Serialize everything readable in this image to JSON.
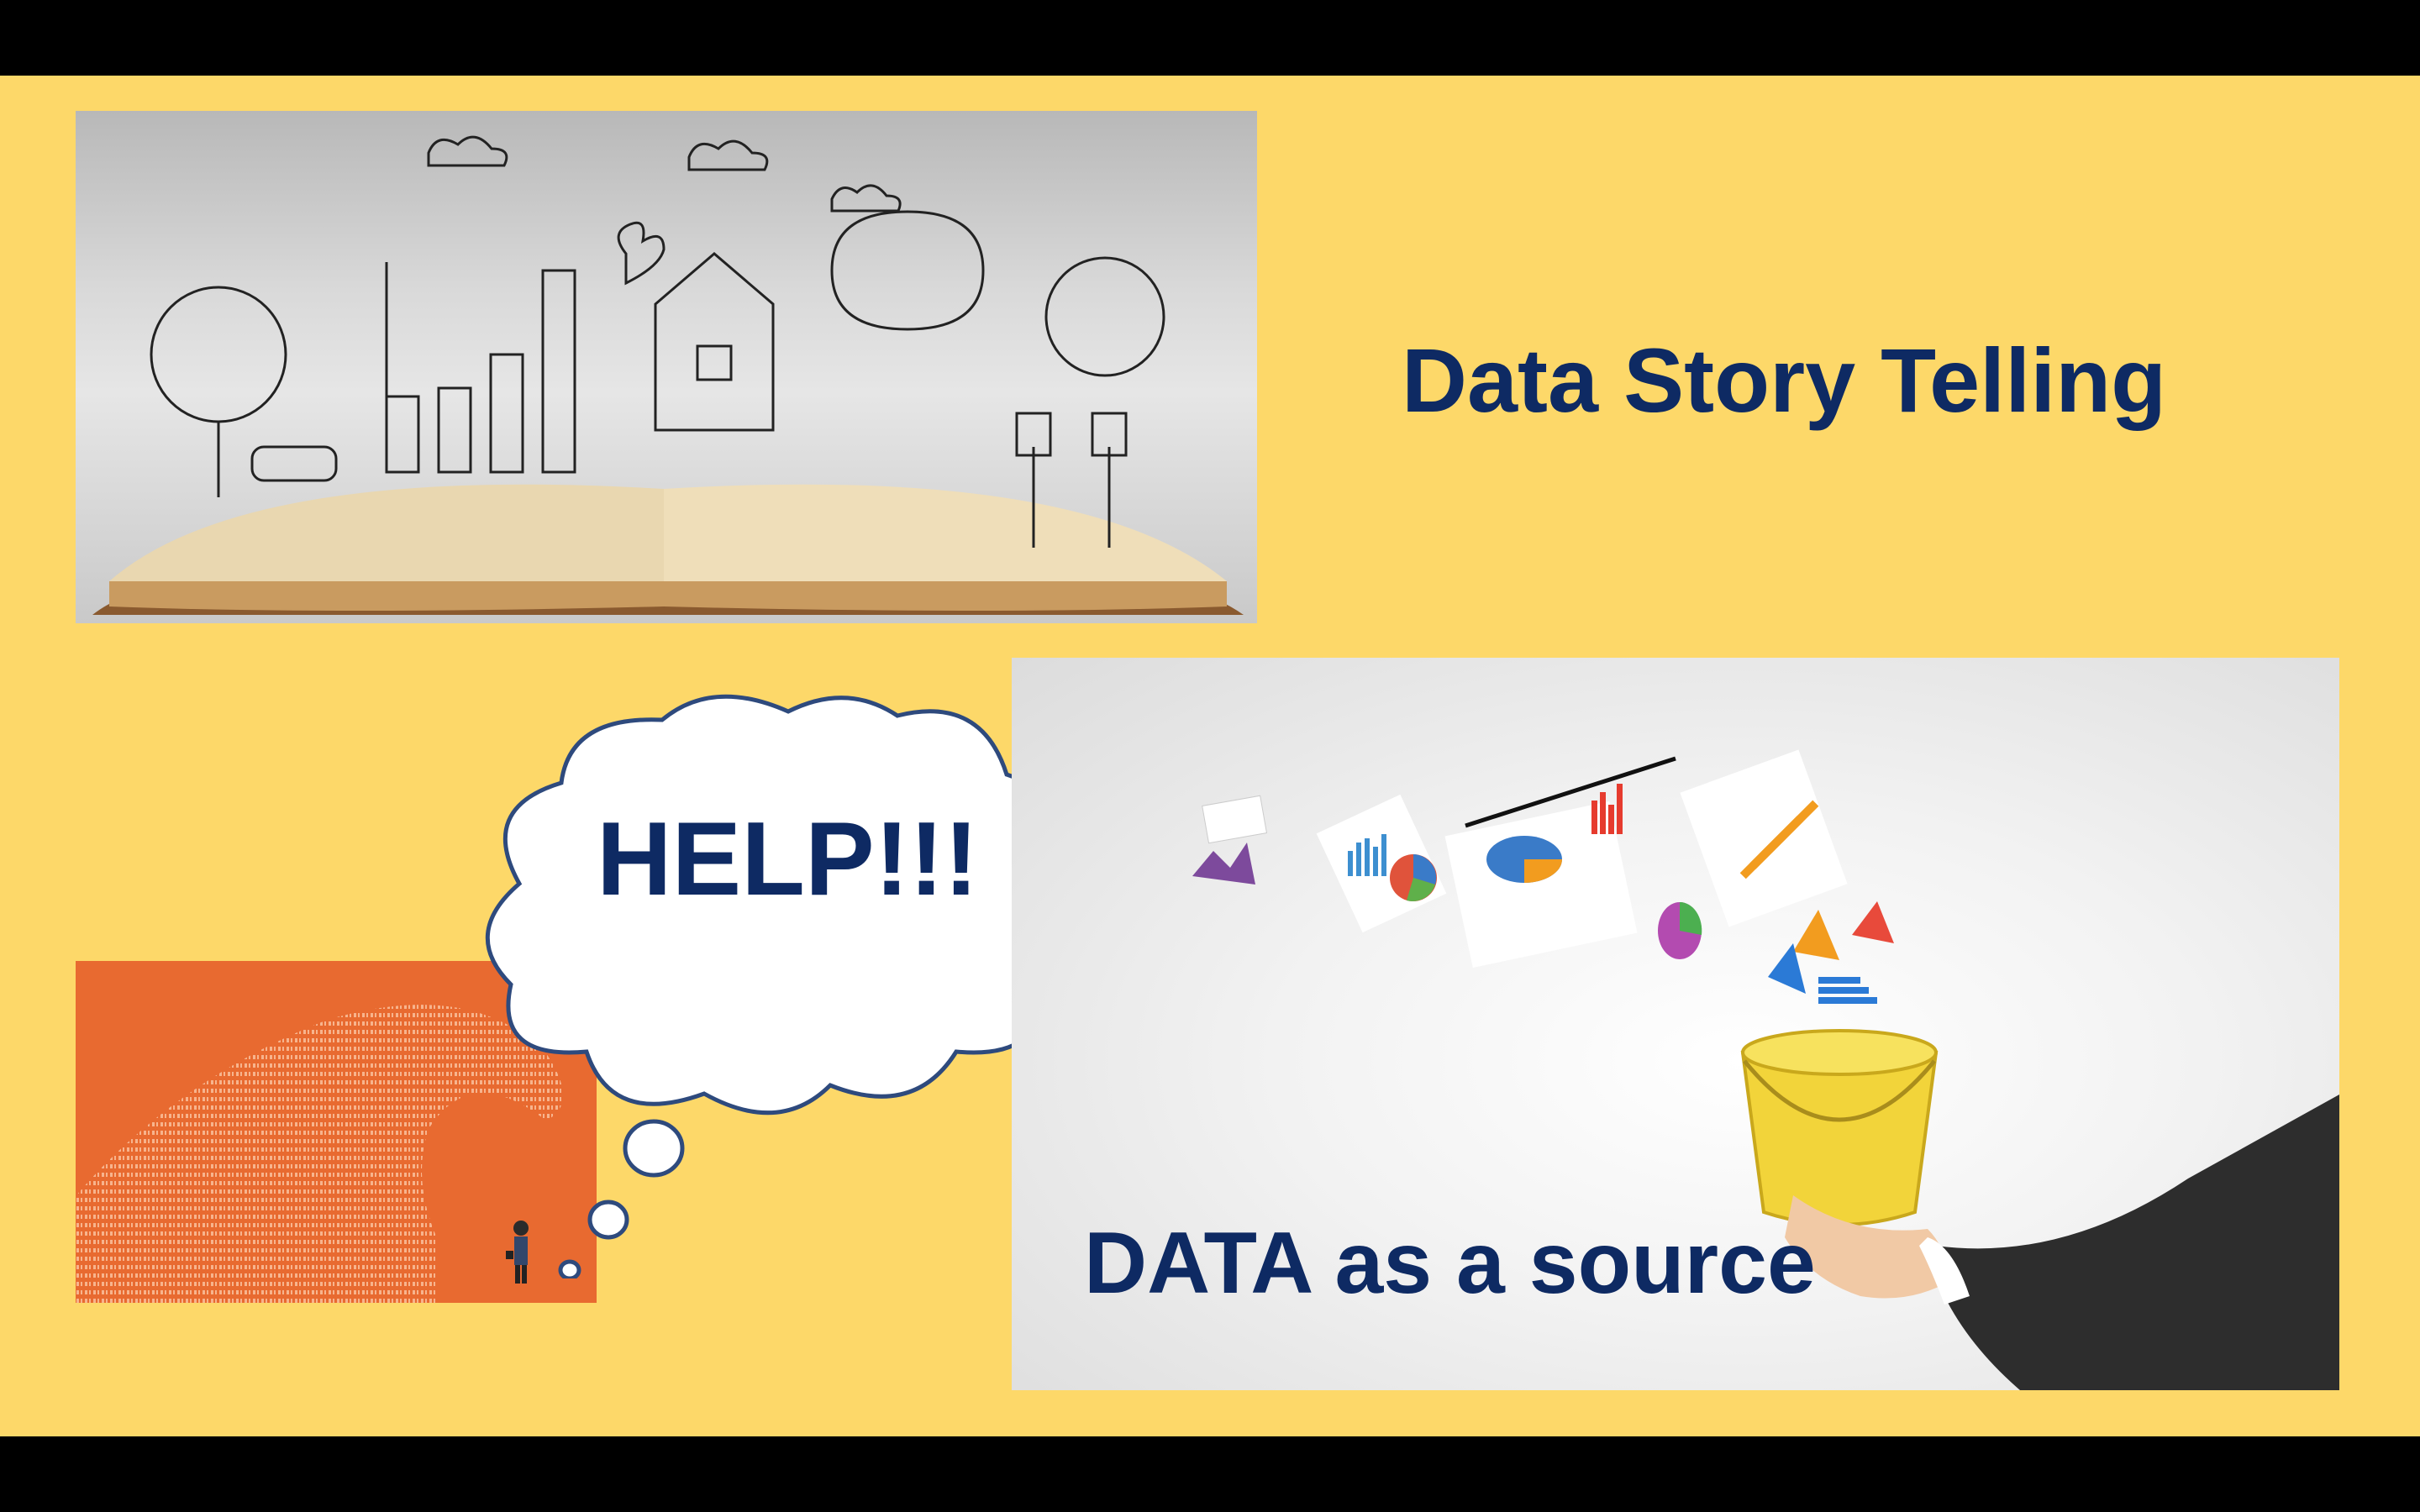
{
  "slide": {
    "title": "Data Story Telling",
    "thought_bubble_text": "HELP!!!",
    "source_caption": "DATA as a source"
  },
  "colors": {
    "slide_background": "#FDD869",
    "letterbox": "#000000",
    "headline_text": "#0E2A63",
    "wave_panel": "#E86A30",
    "bubble_outline": "#2E4A7D"
  },
  "images": {
    "book_illustration": "open-book-with-sketches-icon",
    "data_wave": "binary-wave-over-businessman-icon",
    "data_bucket": "hand-holding-bucket-of-charts-icon"
  }
}
